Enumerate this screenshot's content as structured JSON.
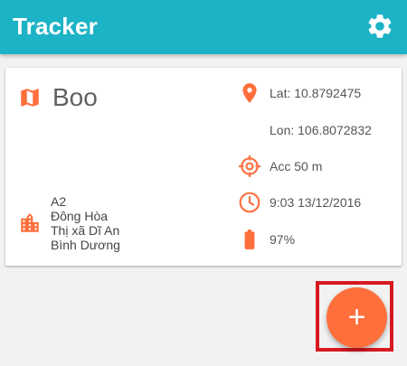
{
  "app": {
    "title": "Tracker"
  },
  "colors": {
    "primary": "#1cb3c6",
    "accent": "#ff6f3c",
    "highlight": "#d71920"
  },
  "icons": {
    "settings": "gear-icon",
    "map": "map-icon",
    "location": "location-pin-icon",
    "accuracy": "crosshair-icon",
    "time": "clock-icon",
    "battery": "battery-icon",
    "address": "city-icon",
    "fab": "plus-icon"
  },
  "device": {
    "name": "Boo",
    "address_lines": [
      "A2",
      "Đông Hòa",
      "Thị xã Dĩ An",
      "Bình Dương"
    ],
    "lat": "Lat: 10.8792475",
    "lon": "Lon: 106.8072832",
    "accuracy": "Acc 50 m",
    "time": "9:03 13/12/2016",
    "battery": "97%"
  },
  "fab": {
    "symbol": "+"
  }
}
